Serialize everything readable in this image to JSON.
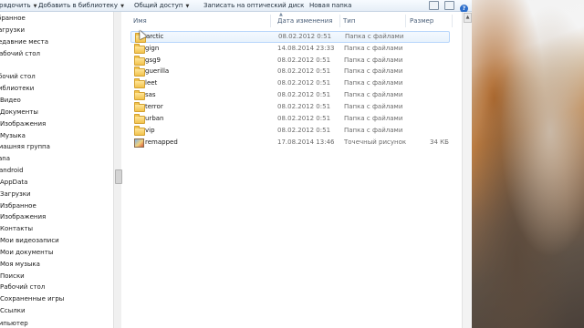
{
  "toolbar": {
    "items": [
      {
        "label": "упорядочить"
      },
      {
        "label": "Добавить в библиотеку"
      },
      {
        "label": "Общий доступ"
      },
      {
        "label": "Записать на оптический диск"
      },
      {
        "label": "Новая папка"
      }
    ]
  },
  "nav": {
    "items": [
      "бранное",
      "агрузки",
      "едавние места",
      "абочий стол",
      "",
      "бочий стол",
      "иблиотеки",
      "Видео",
      "Документы",
      "Изображения",
      "Музыка",
      "машняя группа",
      "ana",
      "android",
      "AppData",
      "Загрузки",
      "Избранное",
      "Изображения",
      "Контакты",
      "Мои видеозаписи",
      "Мои документы",
      "Моя музыка",
      "Поиски",
      "Рабочий стол",
      "Сохраненные игры",
      "Ссылки",
      "мпьютер"
    ]
  },
  "columns": {
    "name": "Имя",
    "date": "Дата изменения",
    "type": "Тип",
    "size": "Размер"
  },
  "files": [
    {
      "name": "arctic",
      "date": "08.02.2012 0:51",
      "type": "Папка с файлами",
      "size": "",
      "icon": "folder-icon"
    },
    {
      "name": "gign",
      "date": "14.08.2014 23:33",
      "type": "Папка с файлами",
      "size": "",
      "icon": "folder-icon"
    },
    {
      "name": "gsg9",
      "date": "08.02.2012 0:51",
      "type": "Папка с файлами",
      "size": "",
      "icon": "folder-icon"
    },
    {
      "name": "guerilla",
      "date": "08.02.2012 0:51",
      "type": "Папка с файлами",
      "size": "",
      "icon": "folder-icon"
    },
    {
      "name": "leet",
      "date": "08.02.2012 0:51",
      "type": "Папка с файлами",
      "size": "",
      "icon": "folder-icon"
    },
    {
      "name": "sas",
      "date": "08.02.2012 0:51",
      "type": "Папка с файлами",
      "size": "",
      "icon": "folder-icon"
    },
    {
      "name": "terror",
      "date": "08.02.2012 0:51",
      "type": "Папка с файлами",
      "size": "",
      "icon": "folder-icon"
    },
    {
      "name": "urban",
      "date": "08.02.2012 0:51",
      "type": "Папка с файлами",
      "size": "",
      "icon": "folder-icon"
    },
    {
      "name": "vip",
      "date": "08.02.2012 0:51",
      "type": "Папка с файлами",
      "size": "",
      "icon": "folder-icon"
    },
    {
      "name": "remapped",
      "date": "17.08.2014 13:46",
      "type": "Точечный рисунок",
      "size": "34 КБ",
      "icon": "bitmap-icon"
    }
  ],
  "colors": {
    "toolbar_text": "#1e2c3a",
    "column_header": "#4c607a",
    "hover_border": "#b8d6fb",
    "folder": "#f2c34c"
  }
}
